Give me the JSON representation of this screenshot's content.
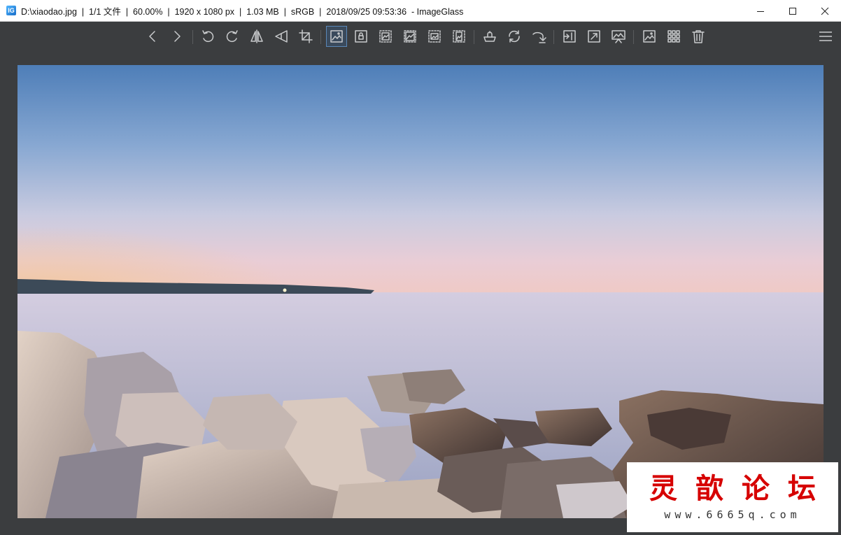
{
  "window": {
    "title": "D:\\xiaodao.jpg  |  1/1 文件  |  60.00%  |  1920 x 1080 px  |  1.03 MB  |  sRGB  |  2018/09/25 09:53:36  - ImageGlass",
    "icon_text": "IG"
  },
  "window_controls": [
    "minimize-icon",
    "maximize-icon",
    "close-icon"
  ],
  "toolbar": {
    "buttons": [
      "view-previous-image-icon",
      "view-next-image-icon",
      "rotate-left-icon",
      "rotate-right-icon",
      "flip-horizontal-icon",
      "flip-vertical-icon",
      "crop-icon",
      "auto-zoom-icon",
      "lock-zoom-ratio-icon",
      "scale-to-width-icon",
      "scale-to-height-icon",
      "scale-to-fit-icon",
      "scale-to-fill-icon",
      "open-with-icon",
      "refresh-icon",
      "go-to-image-icon",
      "fullscreen-icon",
      "expand-icon",
      "slideshow-icon",
      "thumbnail-bar-icon",
      "checkerboard-grid-icon",
      "delete-icon",
      "main-menu-icon"
    ],
    "active_button": "auto-zoom-icon",
    "accent": "#5a88b8"
  },
  "watermark": {
    "title": "灵歆论坛",
    "url": "www.6665q.com",
    "color": "#d60000"
  }
}
